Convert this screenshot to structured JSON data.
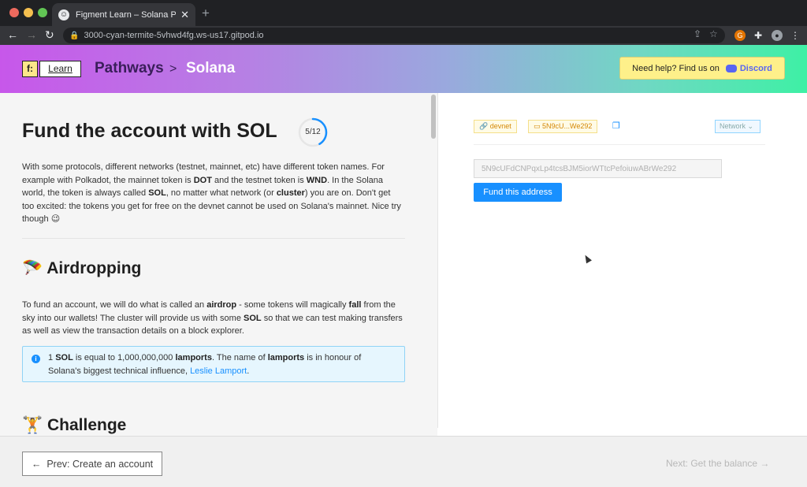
{
  "browser": {
    "tab_title": "Figment Learn – Solana Pathw",
    "close_glyph": "✕",
    "new_tab_glyph": "+",
    "url": "3000-cyan-termite-5vhwd4fg.ws-us17.gitpod.io",
    "back_glyph": "←",
    "forward_glyph": "→",
    "reload_glyph": "↻"
  },
  "header": {
    "logo_letter": "f:",
    "logo_learn": "Learn",
    "breadcrumb": [
      "Pathways",
      "Solana"
    ],
    "separator": ">",
    "help_text": "Need help? Find us on",
    "discord_label": "Discord"
  },
  "main": {
    "title": "Fund the account with SOL",
    "progress": {
      "label": "5/12",
      "current": 5,
      "total": 12
    },
    "intro": {
      "p1": "With some protocols, different networks (testnet, mainnet, etc) have different token names. For example with Polkadot, the mainnet token is ",
      "dot": "DOT",
      "p2": " and the testnet token is ",
      "wnd": "WND",
      "p3": ". In the Solana world, the token is always called ",
      "sol": "SOL",
      "p4": ", no matter what network (or ",
      "cluster": "cluster",
      "p5": ") you are on. Don't get too excited: the tokens you get for free on the devnet cannot be used on Solana's mainnet. Nice try though 😉"
    },
    "airdrop": {
      "emoji": "🪂",
      "heading": "Airdropping",
      "p1": "To fund an account, we will do what is called an ",
      "airdrop": "airdrop",
      "p2": " - some tokens will magically ",
      "fall": "fall",
      "p3": " from the sky into our wallets! The cluster will provide us with some ",
      "sol": "SOL",
      "p4": " so that we can test making transfers as well as view the transaction details on a block explorer."
    },
    "info": {
      "icon": "i",
      "t1": "1 ",
      "sol": "SOL",
      "t2": " is equal to 1,000,000,000 ",
      "lamports": "lamports",
      "t3": ". The name of ",
      "lamports2": "lamports",
      "t4": " is in honour of Solana's biggest technical influence, ",
      "link": "Leslie Lamport",
      "t5": "."
    },
    "challenge": {
      "emoji": "🏋",
      "heading": "Challenge"
    }
  },
  "panel": {
    "network_tag": "devnet",
    "account_tag": "5N9cU...We292",
    "network_select": "Network",
    "address_value": "5N9cUFdCNPqxLp4tcsBJM5iorWTtcPefoiuwABrWe292",
    "fund_button": "Fund this address"
  },
  "footer": {
    "prev_label": "Prev: Create an account",
    "prev_arrow": "←",
    "next_label": "Next: Get the balance",
    "next_arrow": "→"
  },
  "colors": {
    "accent": "#1890ff",
    "tag_text": "#d48806",
    "header_start": "#c757ea",
    "header_end": "#3ef0a5"
  }
}
